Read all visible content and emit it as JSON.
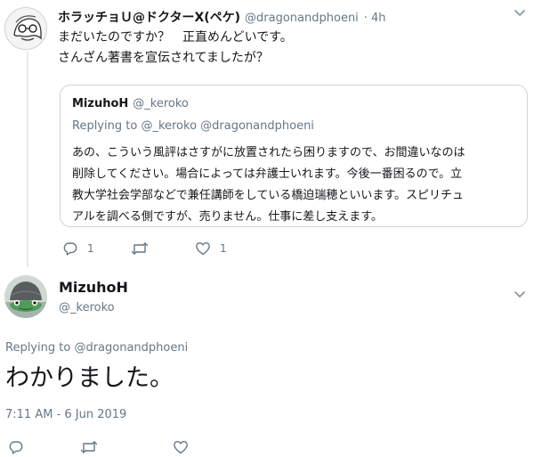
{
  "reply_tweet": {
    "display_name": "ホラッチョＵ@ドクターX(ペケ)",
    "handle": "@dragonandphoeni",
    "separator": "·",
    "time": "4h",
    "text_lines": [
      "まだいたのですか？　正直めんどいです。",
      "さんざん著書を宣伝されてましたが？"
    ],
    "actions": {
      "reply_count": "1",
      "retweet_count": "",
      "like_count": "1"
    }
  },
  "quoted_tweet": {
    "display_name": "MizuhoH",
    "handle": "@_keroko",
    "replying_prefix": "Replying to",
    "replying_handles": "@_keroko @dragonandphoeni",
    "text_lines": [
      "あの、こういう風評はさすがに放置されたら困りますので、お間違いなのは",
      "削除してください。場合によっては弁護士いれます。今後一番困るので。立",
      "教大学社会学部などで兼任講師をしている橋迫瑞穂といいます。スピリチュ",
      "アルを調べる側ですが、売りません。仕事に差し支えます。"
    ]
  },
  "main_tweet": {
    "display_name": "MizuhoH",
    "handle": "@_keroko",
    "replying_prefix": "Replying to",
    "replying_handle": "@dragonandphoeni",
    "text": "わかりました。",
    "timestamp": "7:11 AM - 6 Jun 2019"
  },
  "icons": {
    "reply": "reply-icon",
    "retweet": "retweet-icon",
    "like": "heart-icon",
    "more": "chevron-down-icon"
  },
  "colors": {
    "secondary_text": "#657786",
    "primary_text": "#14171a",
    "border": "#ccd6dd",
    "thread_line": "#e6ecf0"
  }
}
